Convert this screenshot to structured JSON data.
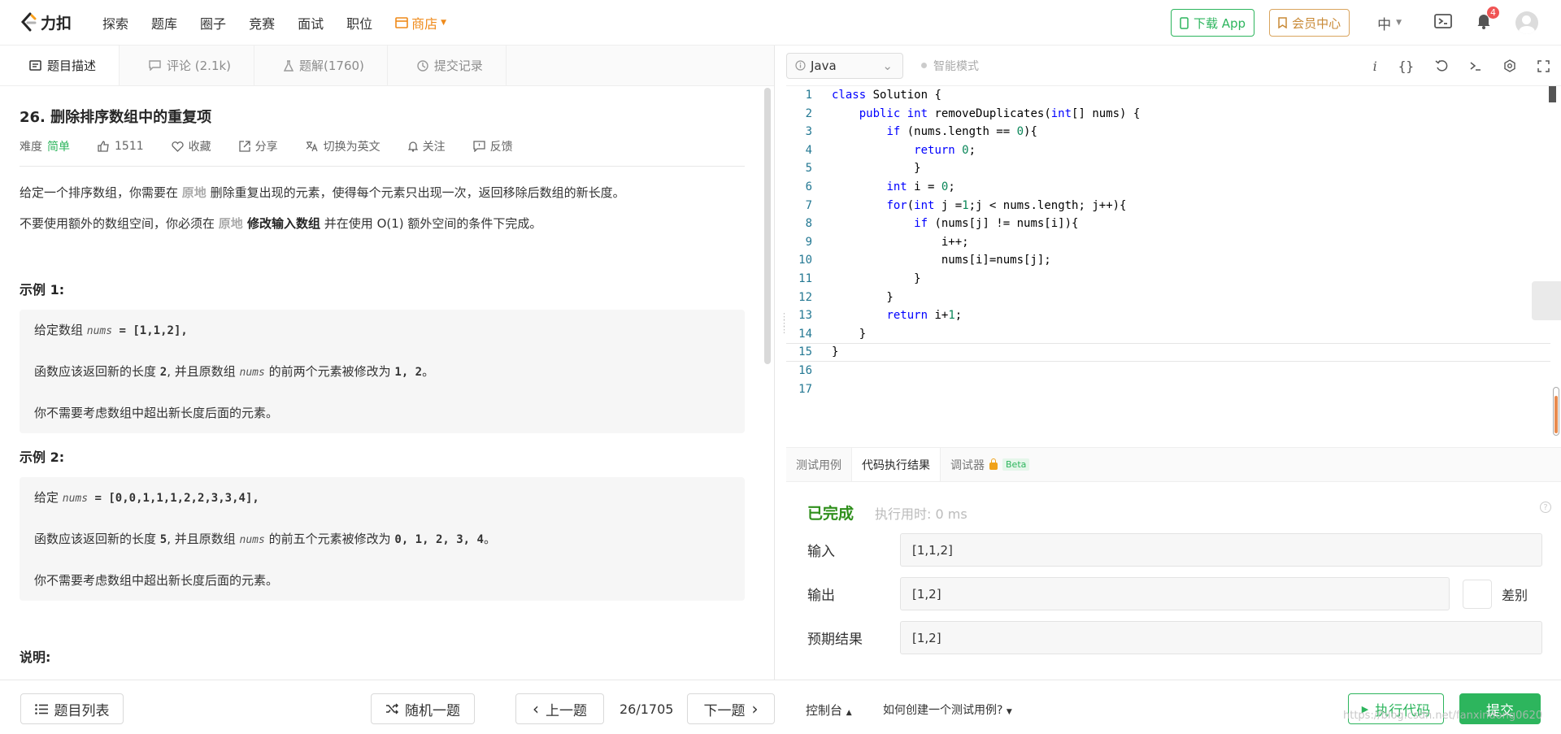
{
  "brand": {
    "name": "力扣"
  },
  "nav": {
    "items": [
      "探索",
      "题库",
      "圈子",
      "竞赛",
      "面试",
      "职位"
    ],
    "shop": "商店"
  },
  "header_right": {
    "download_app": "下载 App",
    "vip": "会员中心",
    "lang": "中",
    "notification_count": "4"
  },
  "left_tabs": [
    {
      "label": "题目描述",
      "icon": "description-icon"
    },
    {
      "label": "评论 (2.1k)",
      "icon": "comment-icon"
    },
    {
      "label": "题解(1760)",
      "icon": "flask-icon"
    },
    {
      "label": "提交记录",
      "icon": "history-icon"
    }
  ],
  "problem": {
    "title": "26. 删除排序数组中的重复项",
    "difficulty_label": "难度",
    "difficulty": "简单",
    "likes": "1511",
    "favorite": "收藏",
    "share": "分享",
    "translate": "切换为英文",
    "follow": "关注",
    "feedback": "反馈",
    "p1": {
      "a": "给定一个排序数组，你需要在 ",
      "hl": "原地",
      "b": " 删除重复出现的元素，使得每个元素只出现一次，返回移除后数组的新长度。"
    },
    "p2": {
      "a": "不要使用额外的数组空间，你必须在 ",
      "hl": "原地",
      "bold": " 修改输入数组",
      "b": " 并在使用 O(1) 额外空间的条件下完成。"
    },
    "example1": {
      "title": "示例 1:",
      "l1a": "给定数组 ",
      "l1var": "nums",
      "l1code": " = [1,1,2],",
      "l2a": "函数应该返回新的长度 ",
      "l2n": "2",
      "l2b": ", 并且原数组 ",
      "l2var": "nums",
      "l2c": " 的前两个元素被修改为 ",
      "l2v": "1, 2",
      "l2d": "。",
      "l3": "你不需要考虑数组中超出新长度后面的元素。"
    },
    "example2": {
      "title": "示例 2:",
      "l1a": "给定 ",
      "l1var": "nums",
      "l1code": " = [0,0,1,1,1,2,2,3,3,4],",
      "l2a": "函数应该返回新的长度 ",
      "l2n": "5",
      "l2b": ", 并且原数组 ",
      "l2var": "nums",
      "l2c": " 的前五个元素被修改为 ",
      "l2v": "0, 1, 2, 3, 4",
      "l2d": "。",
      "l3": "你不需要考虑数组中超出新长度后面的元素。"
    },
    "note_title": "说明:"
  },
  "editor": {
    "language": "Java",
    "smart_mode": "智能模式",
    "line_numbers": [
      "1",
      "2",
      "3",
      "4",
      "5",
      "6",
      "7",
      "8",
      "9",
      "10",
      "11",
      "12",
      "13",
      "14",
      "15",
      "16",
      "17"
    ]
  },
  "console": {
    "tabs": [
      "测试用例",
      "代码执行结果",
      "调试器"
    ],
    "beta": "Beta",
    "status": "已完成",
    "runtime": "执行用时: 0 ms",
    "input_label": "输入",
    "input_value": "[1,1,2]",
    "output_label": "输出",
    "output_value": "[1,2]",
    "diff_label": "差别",
    "expected_label": "预期结果",
    "expected_value": "[1,2]"
  },
  "bottom": {
    "problem_list": "题目列表",
    "random": "随机一题",
    "prev": "上一题",
    "pager": "26/1705",
    "next": "下一题",
    "console": "控制台",
    "howto": "如何创建一个测试用例?",
    "run": "执行代码",
    "submit": "提交",
    "watermark": "https://blog.csdn.net/fanxindong0620"
  },
  "colors": {
    "accent": "#2db55d",
    "shop": "#ef8a1a",
    "done": "#2f8f1c",
    "keyword": "#0000ff",
    "number": "#098658"
  }
}
